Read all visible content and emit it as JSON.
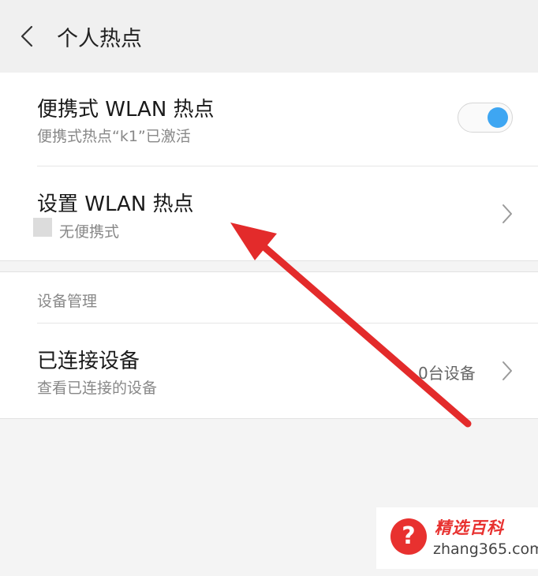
{
  "header": {
    "title": "个人热点"
  },
  "hotspot": {
    "title": "便携式 WLAN 热点",
    "subtitle": "便携式热点“k1”已激活",
    "toggle_on": true
  },
  "setup": {
    "title": "设置 WLAN 热点",
    "subtitle": "无便携式"
  },
  "device_management": {
    "section_label": "设备管理",
    "connected": {
      "title": "已连接设备",
      "subtitle": "查看已连接的设备",
      "value": "0台设备"
    }
  },
  "watermark": {
    "icon_text": "?",
    "name": "精选百科",
    "url": "zhang365.com"
  },
  "colors": {
    "accent": "#3ea6f2",
    "annotation_arrow": "#e32b2b",
    "watermark_red": "#e8312f"
  },
  "icons": [
    "back-arrow-icon",
    "chevron-right-icon",
    "question-mark-icon"
  ]
}
